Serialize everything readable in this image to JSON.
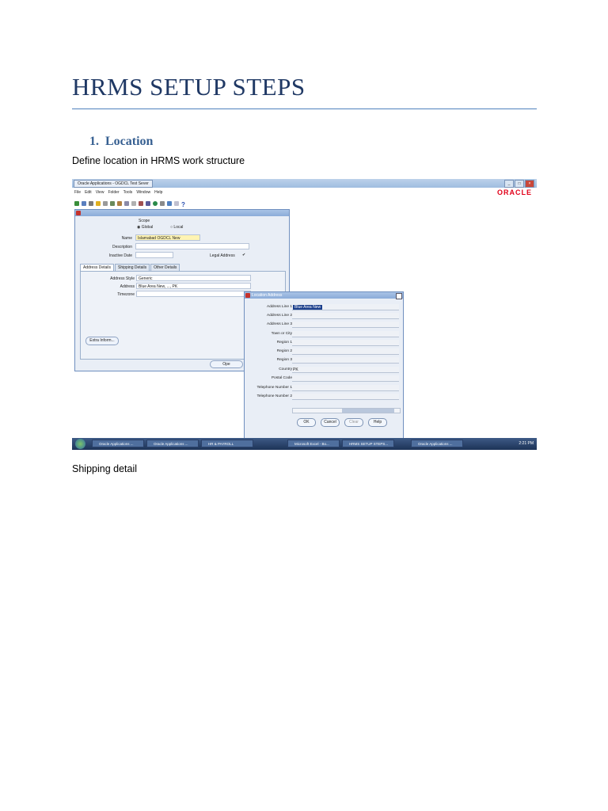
{
  "document": {
    "title": "HRMS SETUP STEPS",
    "section_number": "1.",
    "section_title": "Location",
    "intro_text": "Define location in HRMS work structure",
    "after_text": "Shipping detail"
  },
  "app": {
    "window_title": "Oracle Applications - OGDCL Test Sever",
    "brand": "ORACLE",
    "menu": [
      "File",
      "Edit",
      "View",
      "Folder",
      "Tools",
      "Window",
      "Help"
    ],
    "help_glyph": "?"
  },
  "location_form": {
    "scope_label": "Scope",
    "scope_global": "Global",
    "scope_local": "Local",
    "name_label": "Name",
    "name_value": "Islamabad OGDCL New",
    "description_label": "Description",
    "inactive_date_label": "Inactive Date",
    "legal_address_label": "Legal Address",
    "legal_address_check": "✔",
    "tabs": [
      "Address Details",
      "Shipping Details",
      "Other Details"
    ],
    "address_style_label": "Address Style",
    "address_style_value": "Generic",
    "address_label": "Address",
    "address_value": "Blue Area New, ..., PK",
    "timezone_label": "Timezone",
    "extra_info_button": "Extra Inform...",
    "partial_button": "Ope"
  },
  "location_address_dialog": {
    "title": "Location Address",
    "fields": [
      {
        "label": "Address Line 1",
        "value": "Blue Area New"
      },
      {
        "label": "Address Line 2",
        "value": ""
      },
      {
        "label": "Address Line 3",
        "value": ""
      },
      {
        "label": "Town or City",
        "value": ""
      },
      {
        "label": "Region 1",
        "value": ""
      },
      {
        "label": "Region 2",
        "value": ""
      },
      {
        "label": "Region 3",
        "value": ""
      },
      {
        "label": "Country",
        "value": "PK"
      },
      {
        "label": "Postal Code",
        "value": ""
      },
      {
        "label": "Telephone Number 1",
        "value": ""
      },
      {
        "label": "Telephone Number 2",
        "value": ""
      }
    ],
    "buttons": {
      "ok": "OK",
      "cancel": "Cancel",
      "clear": "Clear",
      "help": "Help"
    }
  },
  "taskbar": {
    "items": [
      "Oracle Applications ...",
      "Oracle Applications ...",
      "HR & PAYROLL",
      "Microsoft Excel - Bo...",
      "HRMS SETUP STEPS...",
      "Oracle Applications ..."
    ],
    "clock": "2:21 PM"
  }
}
